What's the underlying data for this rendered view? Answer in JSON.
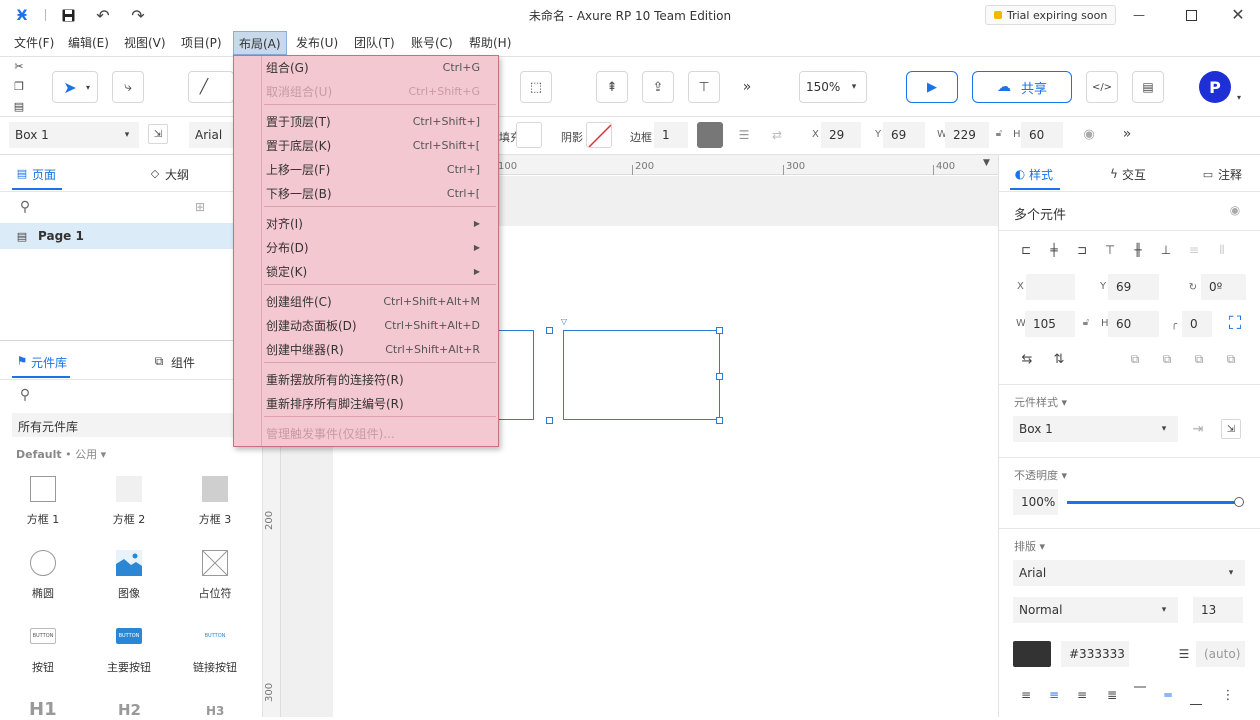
{
  "window": {
    "title": "未命名 - Axure RP 10 Team Edition",
    "trial": "Trial expiring soon"
  },
  "menubar": [
    "文件(F)",
    "编辑(E)",
    "视图(V)",
    "项目(P)",
    "布局(A)",
    "发布(U)",
    "团队(T)",
    "账号(C)",
    "帮助(H)"
  ],
  "layout_menu": {
    "groups": [
      [
        {
          "label": "组合(G)",
          "shortcut": "Ctrl+G",
          "enabled": true
        },
        {
          "label": "取消组合(U)",
          "shortcut": "Ctrl+Shift+G",
          "enabled": false
        }
      ],
      [
        {
          "label": "置于顶层(T)",
          "shortcut": "Ctrl+Shift+]",
          "enabled": true
        },
        {
          "label": "置于底层(K)",
          "shortcut": "Ctrl+Shift+[",
          "enabled": true
        },
        {
          "label": "上移一层(F)",
          "shortcut": "Ctrl+]",
          "enabled": true
        },
        {
          "label": "下移一层(B)",
          "shortcut": "Ctrl+[",
          "enabled": true
        }
      ],
      [
        {
          "label": "对齐(I)",
          "submenu": true,
          "enabled": true
        },
        {
          "label": "分布(D)",
          "submenu": true,
          "enabled": true
        },
        {
          "label": "锁定(K)",
          "submenu": true,
          "enabled": true
        }
      ],
      [
        {
          "label": "创建组件(C)",
          "shortcut": "Ctrl+Shift+Alt+M",
          "enabled": true
        },
        {
          "label": "创建动态面板(D)",
          "shortcut": "Ctrl+Shift+Alt+D",
          "enabled": true
        },
        {
          "label": "创建中继器(R)",
          "shortcut": "Ctrl+Shift+Alt+R",
          "enabled": true
        }
      ],
      [
        {
          "label": "重新摆放所有的连接符(R)",
          "enabled": true
        },
        {
          "label": "重新排序所有脚注编号(R)",
          "enabled": true
        }
      ],
      [
        {
          "label": "管理触发事件(仅组件)...",
          "enabled": false
        }
      ]
    ]
  },
  "toolbar": {
    "zoom": "150%",
    "share": "共享",
    "avatar": "P"
  },
  "stylebar": {
    "widget_select": "Box 1",
    "font": "Arial",
    "fill_label": "填充",
    "shadow_label": "阴影",
    "border_label": "边框",
    "border_value": "1",
    "x_label": "X",
    "x": "29",
    "y_label": "Y",
    "y": "69",
    "w_label": "W",
    "w": "229",
    "h_label": "H",
    "h": "60"
  },
  "left_top": {
    "tab_pages": "页面",
    "tab_outline": "大纲",
    "page_item": "Page 1"
  },
  "left_bottom": {
    "tab_library": "元件库",
    "tab_components": "组件",
    "library_select": "所有元件库",
    "section_bold": "Default",
    "section_rest": " • 公用",
    "items": [
      "方框 1",
      "方框 2",
      "方框 3",
      "椭圆",
      "图像",
      "占位符",
      "按钮",
      "主要按钮",
      "链接按钮"
    ],
    "btn_text": "BUTTON",
    "headings": [
      "H1",
      "H2",
      "H3"
    ]
  },
  "ruler": {
    "top": [
      "100",
      "200",
      "300",
      "400"
    ],
    "left": [
      "200",
      "300"
    ]
  },
  "right": {
    "tab_style": "样式",
    "tab_interact": "交互",
    "tab_notes": "注释",
    "heading": "多个元件",
    "x_label": "X",
    "x": "",
    "y_label": "Y",
    "y": "69",
    "rot": "0º",
    "w_label": "W",
    "w": "105",
    "h_label": "H",
    "h": "60",
    "radius": "0",
    "style_section": "元件样式",
    "style_select": "Box 1",
    "opacity_section": "不透明度",
    "opacity": "100%",
    "opacity_value": 1.0,
    "type_section": "排版",
    "font": "Arial",
    "weight": "Normal",
    "size": "13",
    "color_hex": "#333333",
    "line_height": "(auto)",
    "colors": {
      "text_swatch": "#333333",
      "accent": "#1a73e8"
    }
  }
}
